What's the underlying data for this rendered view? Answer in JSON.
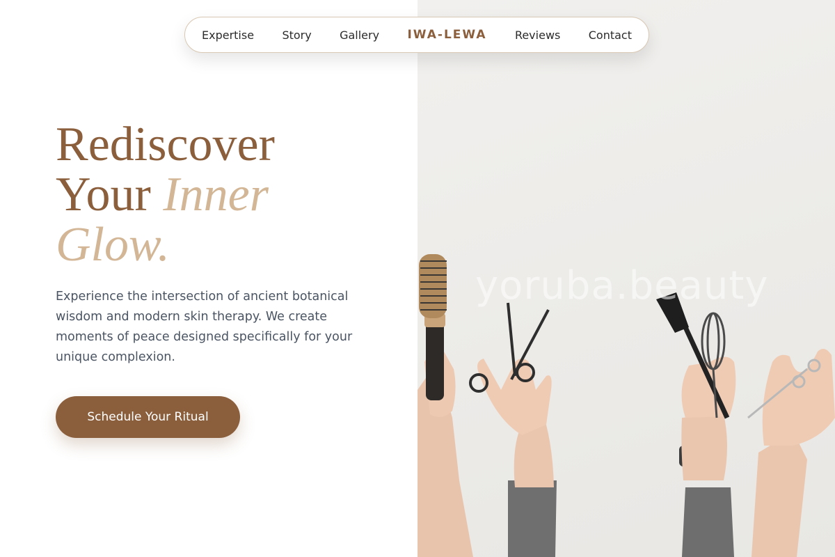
{
  "nav": {
    "links_left": [
      "Expertise",
      "Story",
      "Gallery"
    ],
    "brand": "IWA-LEWA",
    "links_right": [
      "Reviews",
      "Contact"
    ]
  },
  "hero": {
    "title_line1": "Rediscover",
    "title_line2_plain": "Your ",
    "title_line2_accent": "Inner",
    "title_line3_accent": "Glow.",
    "description": "Experience the intersection of ancient botanical wisdom and modern skin therapy. We create moments of peace designed specifically for your unique complexion.",
    "cta_label": "Schedule Your Ritual"
  },
  "image": {
    "watermark": "yoruba.beauty",
    "subject_icons": [
      "hair-brush-icon",
      "scissors-icon",
      "tint-brush-icon",
      "whisk-icon",
      "scissors-icon"
    ]
  },
  "colors": {
    "brand": "#8b5e3c",
    "accent": "#d2b695",
    "body_text": "#4a5462",
    "nav_border": "#d8c7b2",
    "image_bg": "#eeedeb"
  }
}
